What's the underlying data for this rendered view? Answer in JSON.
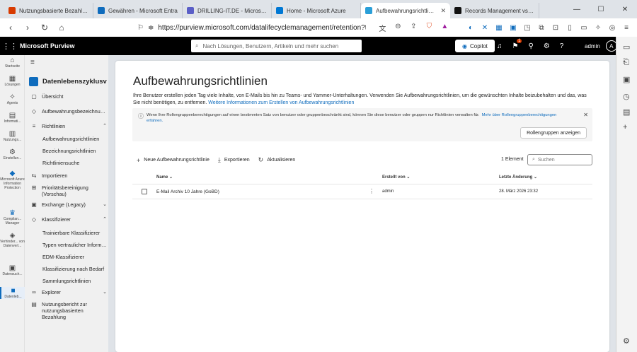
{
  "browser": {
    "tabs": [
      {
        "label": "Nutzungsbasierte Bezahlung",
        "color": "#d83b01",
        "active": false
      },
      {
        "label": "Gewähren - Microsoft Entra",
        "color": "#0f6cbd",
        "active": false
      },
      {
        "label": "DRILLING-IT.DE - Microsoft",
        "color": "#5b5fc7",
        "active": false
      },
      {
        "label": "Home - Microsoft Azure",
        "color": "#0078d4",
        "active": false
      },
      {
        "label": "Aufbewahrungsrichtlinien",
        "color": "#2a9fd8",
        "active": true
      },
      {
        "label": "Records Management vs. D",
        "color": "#111111",
        "active": false
      }
    ],
    "url": "https://purview.microsoft.com/datalifecyclemanagement/retention?tid=..."
  },
  "topbar": {
    "brand": "Microsoft Purview",
    "search_placeholder": "Nach Lösungen, Benutzern, Artikeln und mehr suchen",
    "copilot_label": "Copilot",
    "notification_count": "1",
    "user_name": "admin",
    "avatar_initial": "A"
  },
  "rail": [
    {
      "label": "Startseite",
      "icon": "home-icon",
      "glyph": "⌂"
    },
    {
      "label": "Lösungen",
      "icon": "grid-icon",
      "glyph": "▦"
    },
    {
      "label": "Agents",
      "icon": "agents-icon",
      "glyph": "✧"
    },
    {
      "label": "Informati...",
      "icon": "info-icon",
      "glyph": "▤"
    },
    {
      "label": "Nutzungs...",
      "icon": "chart-icon",
      "glyph": "▥"
    },
    {
      "label": "Einstellun...",
      "icon": "settings-icon",
      "glyph": "⚙"
    },
    {
      "label": "Microsoft Azure Information Protection",
      "icon": "azure-icon",
      "glyph": "◆"
    },
    {
      "label": "Complian... Manager",
      "icon": "trophy-icon",
      "glyph": "♛"
    },
    {
      "label": "Verhinder... von Datenverl...",
      "icon": "shield-icon",
      "glyph": "◈"
    },
    {
      "label": "Datensuch...",
      "icon": "search-icon",
      "glyph": "▣"
    },
    {
      "label": "Datenleb...",
      "icon": "lifecycle-icon",
      "glyph": "■"
    }
  ],
  "nav": {
    "title": "Datenlebenszyklusverwaltung",
    "items": [
      {
        "label": "Übersicht",
        "glyph": "▢"
      },
      {
        "label": "Aufbewahrungsbezeichnungen",
        "glyph": "◇"
      },
      {
        "label": "Richtlinien",
        "glyph": "≡",
        "chevron": "⌃"
      },
      {
        "label": "Aufbewahrungsrichtlinien",
        "sub": true,
        "active": true
      },
      {
        "label": "Bezeichnungsrichtlinien",
        "sub": true
      },
      {
        "label": "Richtliniensuche",
        "sub": true
      },
      {
        "label": "Importieren",
        "glyph": "⇆"
      },
      {
        "label": "Prioritätsbereinigung (Vorschau)",
        "glyph": "⊞"
      },
      {
        "label": "Exchange (Legacy)",
        "glyph": "▣",
        "chevron": "⌄"
      },
      {
        "label": "Klassifizierer",
        "glyph": "◇",
        "chevron": "⌃"
      },
      {
        "label": "Trainierbare Klassifizierer",
        "sub": true
      },
      {
        "label": "Typen vertraulicher Informationen",
        "sub": true
      },
      {
        "label": "EDM-Klassifizierer",
        "sub": true
      },
      {
        "label": "Klassifizierung nach Bedarf",
        "sub": true
      },
      {
        "label": "Sammlungsrichtlinien",
        "sub": true
      },
      {
        "label": "Explorer",
        "glyph": "∞",
        "chevron": "⌄"
      },
      {
        "label": "Nutzungsbericht zur nutzungsbasierten Bezahlung",
        "glyph": "▤"
      }
    ]
  },
  "main": {
    "title": "Aufbewahrungsrichtlinien",
    "description": "Ihre Benutzer erstellen jeden Tag viele Inhalte, von E-Mails bis hin zu Teams- und Yammer-Unterhaltungen. Verwenden Sie Aufbewahrungsrichtlinien, um die gewünschten Inhalte beizubehalten und das, was Sie nicht benötigen, zu entfernen.",
    "description_link": " Weitere Informationen zum Erstellen von Aufbewahrungsrichtlinien",
    "info_text": "Wenn Ihre Rollengruppenberechtigungen auf einen bestimmten Satz von benutzer oder gruppenbeschränkt sind, können Sie diese benutzer oder gruppen nur Richtlinien verwalten für.",
    "info_link": "Mehr über Rollengruppenberechtigungen erfahren.",
    "role_button": "Rollengruppen anzeigen",
    "toolbar": {
      "new_label": "Neue Aufbewahrungsrichtlinie",
      "export_label": "Exportieren",
      "refresh_label": "Aktualisieren"
    },
    "count_label": "1 Element",
    "search_placeholder": "Suchen",
    "columns": {
      "name": "Name",
      "created_by": "Erstellt von",
      "last_modified": "Letzte Änderung"
    },
    "rows": [
      {
        "name": "E-Mail Archiv 10 Jahre (GoBD)",
        "created_by": "admin",
        "last_modified": "28. März 2026 23:32"
      }
    ]
  }
}
